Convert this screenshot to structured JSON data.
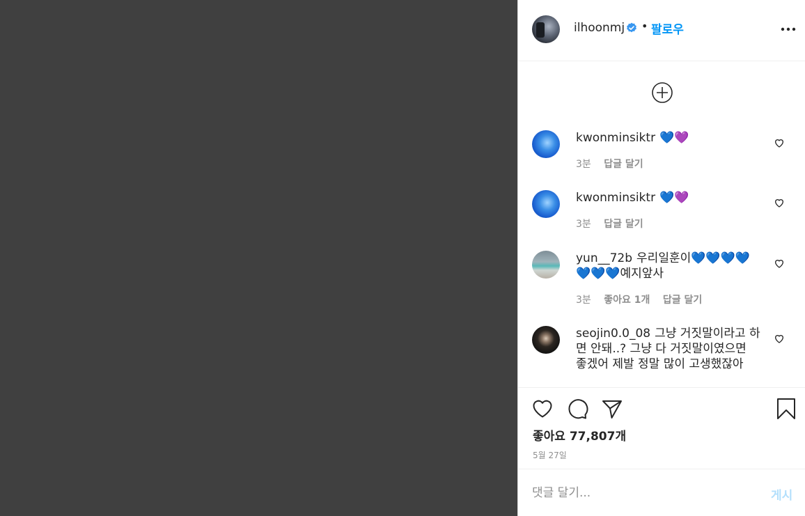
{
  "header": {
    "username": "ilhoonmj",
    "separator": "•",
    "follow_label": "팔로우"
  },
  "comments": [
    {
      "username": "kwonminsiktr",
      "text": "💙💜",
      "time": "3분",
      "likes": "",
      "reply_label": "답글 달기",
      "avatar": "blue"
    },
    {
      "username": "kwonminsiktr",
      "text": "💙💜",
      "time": "3분",
      "likes": "",
      "reply_label": "답글 달기",
      "avatar": "blue"
    },
    {
      "username": "yun__72b",
      "text": "우리일훈이💙💙💙💙💙💙💙예지앞사",
      "time": "3분",
      "likes": "좋아요 1개",
      "reply_label": "답글 달기",
      "avatar": "sea"
    },
    {
      "username": "seojin0.0_08",
      "text": "그냥 거짓말이라고 하면 안돼..? 그냥 다 거짓말이였으면 좋겠어 제발 정말 많이 고생했잖아",
      "time": "",
      "likes": "",
      "reply_label": "",
      "avatar": "dark"
    }
  ],
  "actions": {
    "likes_label": "좋아요",
    "likes_count": "77,807개",
    "date": "5월 27일"
  },
  "composer": {
    "placeholder": "댓글 달기...",
    "post_label": "게시"
  },
  "icons": {
    "verified": "verified-badge-icon",
    "more": "more-options-icon",
    "load_more": "plus-circle-icon",
    "like": "heart-icon",
    "comment": "comment-icon",
    "share": "share-icon",
    "save": "bookmark-icon"
  },
  "colors": {
    "accent": "#0095f6",
    "media_background": "#404040",
    "muted": "#8e8e8e"
  }
}
